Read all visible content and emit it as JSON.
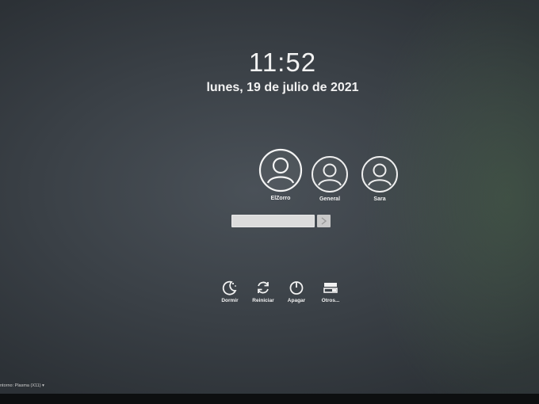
{
  "clock": {
    "time": "11:52",
    "date": "lunes, 19 de julio de 2021"
  },
  "users": [
    {
      "name": "ElZorro",
      "icon": "user-avatar-icon",
      "selected": true
    },
    {
      "name": "General",
      "icon": "user-avatar-icon",
      "selected": false
    },
    {
      "name": "Sara",
      "icon": "user-avatar-icon",
      "selected": false
    }
  ],
  "login": {
    "password_value": "",
    "submit_icon": "arrow-right-icon"
  },
  "actions": [
    {
      "label": "Dormir",
      "icon": "moon-icon"
    },
    {
      "label": "Reiniciar",
      "icon": "restart-icon"
    },
    {
      "label": "Apagar",
      "icon": "power-icon"
    },
    {
      "label": "Otros...",
      "icon": "other-icon"
    }
  ],
  "session": {
    "label": "ntorno: Plasma (X11) ▾"
  },
  "colors": {
    "background": "#3a4046",
    "text": "#f2f2f2",
    "field": "#dcdcdc"
  }
}
